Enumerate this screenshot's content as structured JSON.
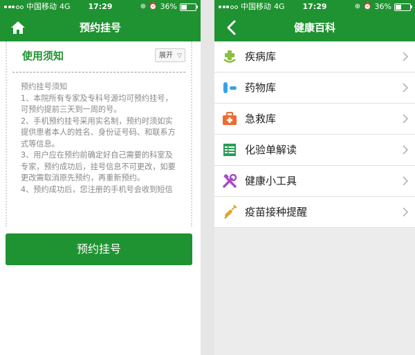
{
  "status_bar": {
    "carrier": "中国移动",
    "network": "4G",
    "time": "17:29",
    "battery": "36%",
    "battery_level": 0.36
  },
  "left_screen": {
    "title": "预约挂号",
    "home_icon": "home-icon",
    "notice": {
      "title": "使用须知",
      "toggle_label": "展开",
      "lines": [
        "预约挂号须知",
        "1、本院所有专家及专科号源均可预约挂号，可预约提前三天到一周的号。",
        "2、手机预约挂号采用实名制，预约时须如实提供患者本人的姓名、身份证号码、和联系方式等信息。",
        "3、用户应在预约前确定好自己需要的科室及专家，预约成功后，挂号信息不可更改，如要更改需取消原先预约，再重新预约。",
        "4、预约成功后，您注册的手机号会收到短信"
      ]
    },
    "book_button": "预约挂号"
  },
  "right_screen": {
    "title": "健康百科",
    "back_icon": "back-icon",
    "menu": [
      {
        "label": "疾病库",
        "icon": "disease-cross-icon",
        "color": "#8bbf3c"
      },
      {
        "label": "药物库",
        "icon": "pill-icon",
        "color": "#3aa1e6"
      },
      {
        "label": "急救库",
        "icon": "first-aid-kit-icon",
        "color": "#ee6b2f"
      },
      {
        "label": "化验单解读",
        "icon": "lab-report-icon",
        "color": "#2a9d58"
      },
      {
        "label": "健康小工具",
        "icon": "tools-icon",
        "color": "#a44bc8"
      },
      {
        "label": "疫苗接种提醒",
        "icon": "syringe-icon",
        "color": "#e0a82b"
      }
    ]
  },
  "colors": {
    "brand_green": "#1f9331",
    "notice_text": "#888888"
  }
}
